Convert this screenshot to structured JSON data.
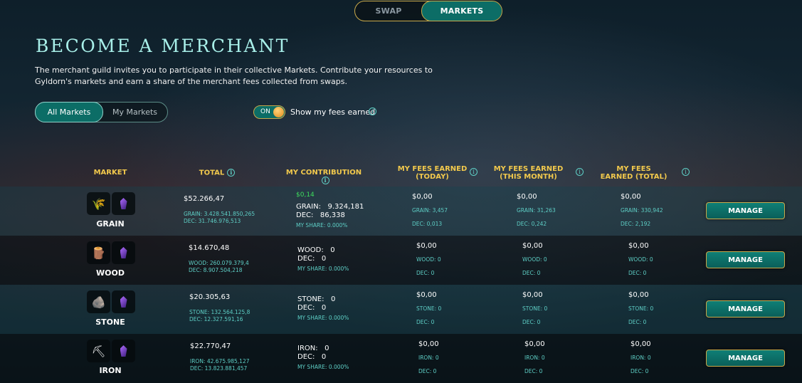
{
  "nav": {
    "swap_label": "SWAP",
    "markets_label": "MARKETS"
  },
  "page": {
    "title": "BECOME A MERCHANT",
    "intro": "The merchant guild invites you to participate in their collective Markets. Contribute your resources to Gyldorn's markets and earn a share of the merchant fees collected from swaps."
  },
  "filters": {
    "all_label": "All Markets",
    "mine_label": "My Markets"
  },
  "fees_toggle": {
    "state_label": "ON",
    "label": "Show my fees earned"
  },
  "columns": {
    "market": "MARKET",
    "total": "TOTAL",
    "contribution": "MY CONTRIBUTION",
    "fees_today": "MY FEES EARNED (TODAY)",
    "fees_month": "MY FEES EARNED (THIS MONTH)",
    "fees_total": "MY FEES EARNED (TOTAL)"
  },
  "colors": {
    "accent": "#0c6d66",
    "gold": "#f2c94c",
    "teal_text": "#5ecfc6",
    "title": "#a8efe9"
  },
  "rows": [
    {
      "name": "GRAIN",
      "icon": "wheat-icon",
      "total": "$52.266,47",
      "total_res": "GRAIN: 3.428.541.850,265",
      "total_dec": "DEC: 31.746.976,513",
      "contrib_value": "$0,14",
      "contrib_res": "GRAIN:   9.324,181",
      "contrib_dec": "DEC:   86,338",
      "share": "MY SHARE: 0.000%",
      "today": "$0,00",
      "today_res": "GRAIN: 3,457",
      "today_dec": "DEC: 0,013",
      "month": "$0,00",
      "month_res": "GRAIN: 31,263",
      "month_dec": "DEC: 0,242",
      "total_fees": "$0,00",
      "total_fees_res": "GRAIN: 330,942",
      "total_fees_dec": "DEC: 2,192",
      "manage": "MANAGE"
    },
    {
      "name": "WOOD",
      "icon": "logs-icon",
      "total": "$14.670,48",
      "total_res": "WOOD: 260.079.379,4",
      "total_dec": "DEC: 8.907.504,218",
      "contrib_value": "",
      "contrib_res": "WOOD:   0",
      "contrib_dec": "DEC:   0",
      "share": "MY SHARE: 0.000%",
      "today": "$0,00",
      "today_res": "WOOD: 0",
      "today_dec": "DEC: 0",
      "month": "$0,00",
      "month_res": "WOOD: 0",
      "month_dec": "DEC: 0",
      "total_fees": "$0,00",
      "total_fees_res": "WOOD: 0",
      "total_fees_dec": "DEC: 0",
      "manage": "MANAGE"
    },
    {
      "name": "STONE",
      "icon": "stone-icon",
      "total": "$20.305,63",
      "total_res": "STONE: 132.564.125,8",
      "total_dec": "DEC: 12.327.591,16",
      "contrib_value": "",
      "contrib_res": "STONE:   0",
      "contrib_dec": "DEC:   0",
      "share": "MY SHARE: 0.000%",
      "today": "$0,00",
      "today_res": "STONE: 0",
      "today_dec": "DEC: 0",
      "month": "$0,00",
      "month_res": "STONE: 0",
      "month_dec": "DEC: 0",
      "total_fees": "$0,00",
      "total_fees_res": "STONE: 0",
      "total_fees_dec": "DEC: 0",
      "manage": "MANAGE"
    },
    {
      "name": "IRON",
      "icon": "iron-ore-icon",
      "total": "$22.770,47",
      "total_res": "IRON: 42.675.985,127",
      "total_dec": "DEC: 13.823.881,457",
      "contrib_value": "",
      "contrib_res": "IRON:   0",
      "contrib_dec": "DEC:   0",
      "share": "MY SHARE: 0.000%",
      "today": "$0,00",
      "today_res": "IRON: 0",
      "today_dec": "DEC: 0",
      "month": "$0,00",
      "month_res": "IRON: 0",
      "month_dec": "DEC: 0",
      "total_fees": "$0,00",
      "total_fees_res": "IRON: 0",
      "total_fees_dec": "DEC: 0",
      "manage": "MANAGE"
    }
  ]
}
